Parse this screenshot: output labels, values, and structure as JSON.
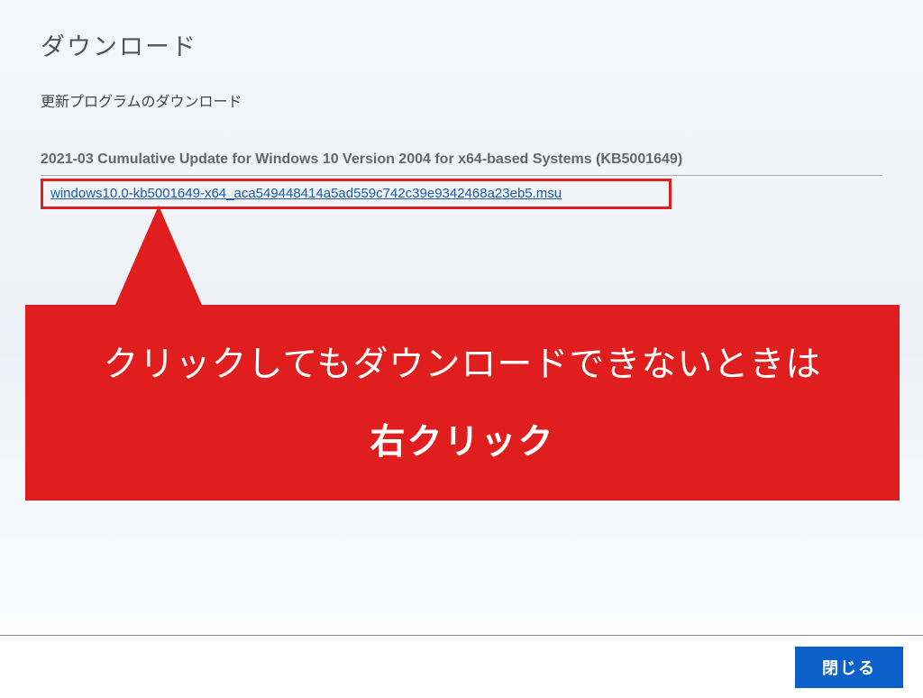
{
  "page_title": "ダウンロード",
  "subtitle": "更新プログラムのダウンロード",
  "update_title": "2021-03 Cumulative Update for Windows 10 Version 2004 for x64-based Systems (KB5001649)",
  "download_link_text": "windows10.0-kb5001649-x64_aca549448414a5ad559c742c39e9342468a23eb5.msu",
  "callout": {
    "line1": "クリックしてもダウンロードできないときは",
    "line2": "右クリック"
  },
  "footer": {
    "close_label": "閉じる"
  }
}
